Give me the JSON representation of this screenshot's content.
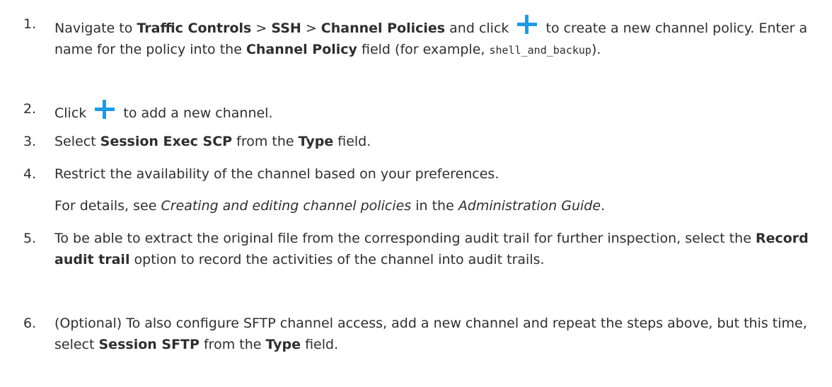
{
  "steps": [
    {
      "num": "1.",
      "p1": "Navigate to ",
      "b1": "Traffic Controls",
      "p2": " > ",
      "b2": "SSH",
      "p3": " > ",
      "b3": "Channel Policies",
      "p4": " and click ",
      "p5": " to create a new channel policy. Enter a name for the policy into the ",
      "b4": "Channel Policy",
      "p6": " field (for example, ",
      "code": "shell_and_backup",
      "p7": ")."
    },
    {
      "num": "2.",
      "p1": "Click ",
      "p2": " to add a new channel."
    },
    {
      "num": "3.",
      "p1": "Select ",
      "b1": "Session Exec SCP",
      "p2": " from the ",
      "b2": "Type",
      "p3": " field."
    },
    {
      "num": "4.",
      "p1": "Restrict the availability of the channel based on your preferences.",
      "s1": "For details, see ",
      "i1": "Creating and editing channel policies",
      "s2": " in the ",
      "i2": "Administration Guide",
      "s3": "."
    },
    {
      "num": "5.",
      "p1": "To be able to extract the original file from the corresponding audit trail for further inspection, select the ",
      "b1": "Record audit trail",
      "p2": " option to record the activities of the channel into audit trails."
    },
    {
      "num": "6.",
      "p1": "(Optional) To also configure SFTP channel access, add a new channel and repeat the steps above, but this time, select ",
      "b1": "Session SFTP",
      "p2": " from the ",
      "b2": "Type",
      "p3": " field."
    }
  ],
  "icons": {
    "plus": "plus-icon",
    "accent": "#1d9be8"
  }
}
